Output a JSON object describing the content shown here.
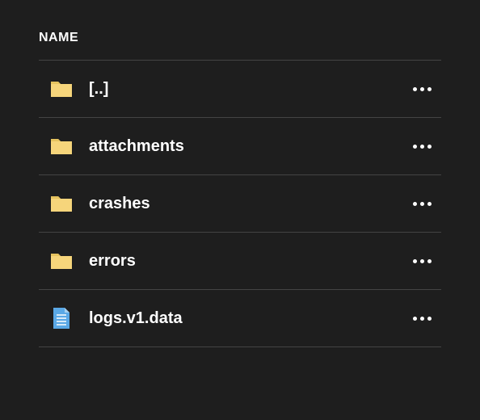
{
  "header": {
    "name_label": "NAME"
  },
  "colors": {
    "folder_fill": "#f6d57b",
    "folder_tab": "#e6c35f",
    "file_fill": "#5aa8e6",
    "file_lines": "#ffffff"
  },
  "items": [
    {
      "name": "[..]",
      "type": "folder"
    },
    {
      "name": "attachments",
      "type": "folder"
    },
    {
      "name": "crashes",
      "type": "folder"
    },
    {
      "name": "errors",
      "type": "folder"
    },
    {
      "name": "logs.v1.data",
      "type": "file"
    }
  ]
}
